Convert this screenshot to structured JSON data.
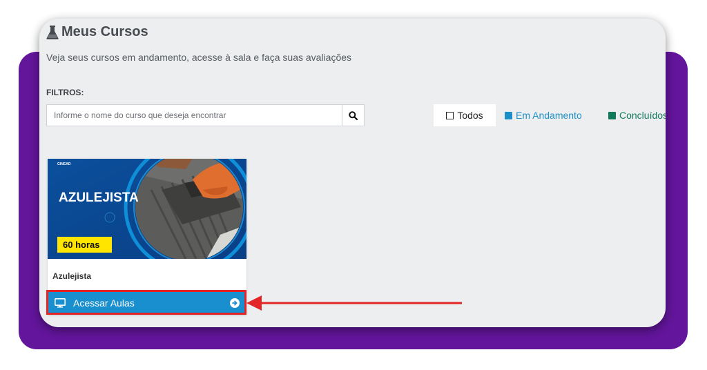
{
  "header": {
    "title": "Meus Cursos",
    "subtitle": "Veja seus cursos em andamento, acesse à sala e faça suas avaliações"
  },
  "filters": {
    "label": "FILTROS:",
    "search_placeholder": "Informe o nome do curso que deseja encontrar",
    "search_value": "",
    "options": [
      {
        "label": "Todos",
        "color": "#222222"
      },
      {
        "label": "Em Andamento",
        "color": "#1d8fc7"
      },
      {
        "label": "Concluídos",
        "color": "#127a5c"
      }
    ]
  },
  "course": {
    "image_brand": "GINEAD",
    "image_title": "AZULEJISTA",
    "image_badge": "60 horas",
    "title": "Azulejista",
    "action_label": "Acessar Aulas"
  },
  "colors": {
    "accent": "#1a8fcf",
    "brand_purple": "#63159c",
    "highlight_red": "#e42527"
  },
  "icons": [
    "flask-icon",
    "search-icon",
    "monitor-icon",
    "arrow-circle-right-icon"
  ]
}
